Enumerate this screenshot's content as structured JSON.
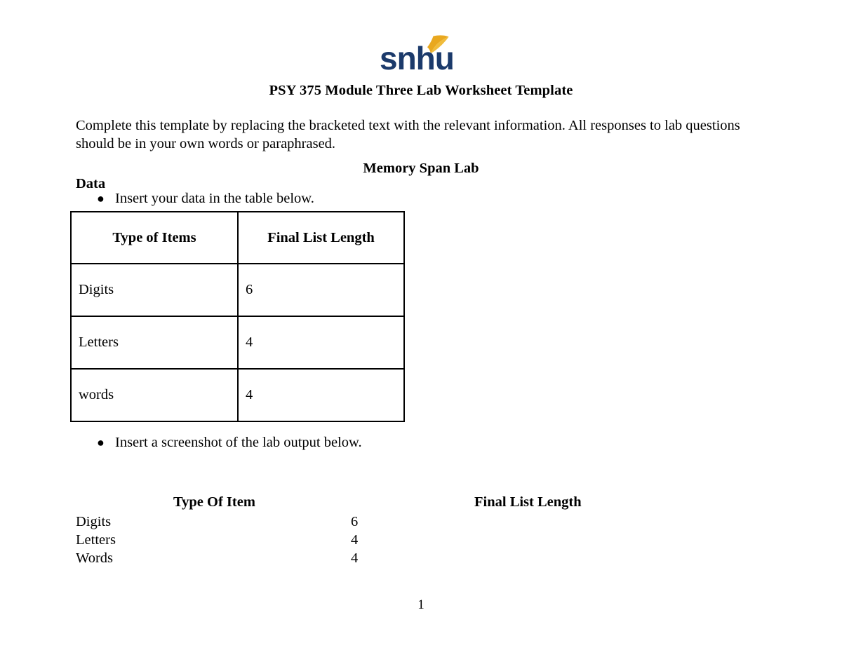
{
  "document": {
    "logo": {
      "icon": "snhu-logo",
      "wordmark": "snhu",
      "text_color": "#1B3A6B",
      "leaf_color": "#E9A81F"
    },
    "title": "PSY 375 Module Three Lab Worksheet Template",
    "intro_paragraph": "Complete this template by replacing the bracketed text with the relevant information. All responses to lab questions should be in your own words or paraphrased.",
    "lab_heading": "Memory Span Lab",
    "data_label": "Data",
    "bullets": [
      "Insert your data in the table below.",
      "Insert a screenshot of the lab output below."
    ],
    "bullet_glyph": "●",
    "data_table": {
      "headers": [
        "Type of Items",
        "Final List Length"
      ],
      "rows": [
        [
          "Digits",
          "6"
        ],
        [
          "Letters",
          "4"
        ],
        [
          "words",
          "4"
        ]
      ]
    },
    "lab_output": {
      "headers": [
        "Type Of Item",
        "Final List Length"
      ],
      "rows": [
        [
          "Digits",
          "6"
        ],
        [
          "Letters",
          "4"
        ],
        [
          "Words",
          "4"
        ]
      ]
    },
    "page_number": "1"
  }
}
